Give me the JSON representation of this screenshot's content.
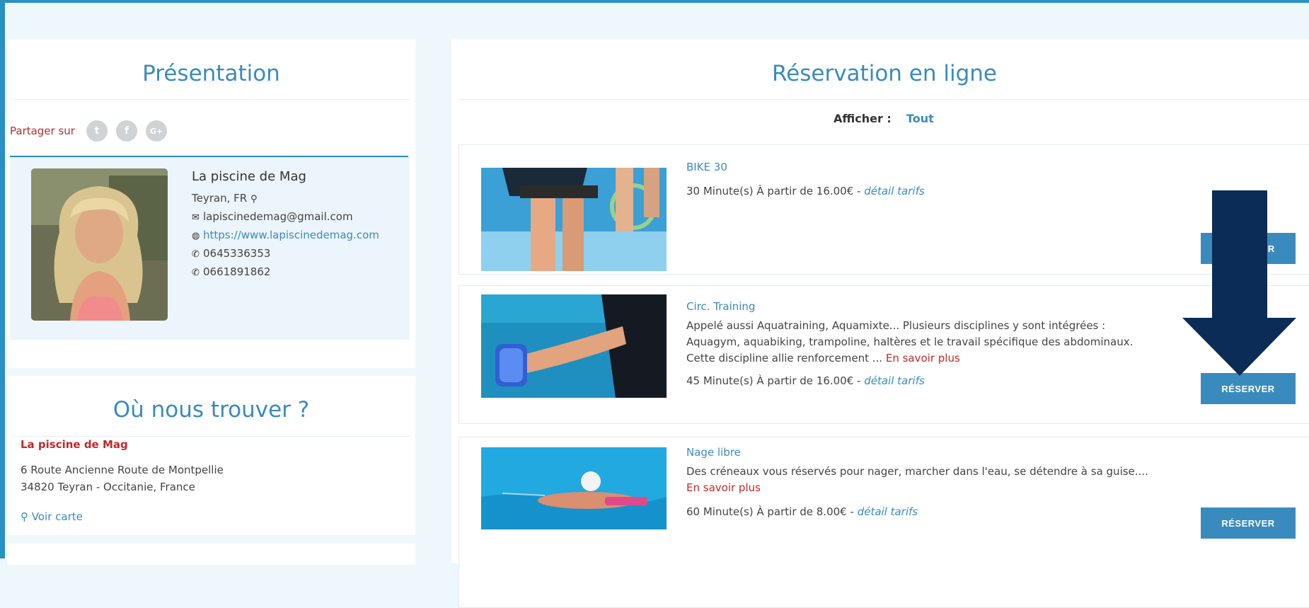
{
  "presentation": {
    "title": "Présentation",
    "share_label": "Partager sur",
    "social": [
      {
        "icon": "twitter-icon",
        "glyph": "t"
      },
      {
        "icon": "facebook-icon",
        "glyph": "f"
      },
      {
        "icon": "google-plus-icon",
        "glyph": "G+"
      }
    ],
    "profile": {
      "name": "La piscine de Mag",
      "location": "Teyran, FR",
      "email": "lapiscinedemag@gmail.com",
      "website": "https://www.lapiscinedemag.com",
      "phone1": "0645336353",
      "phone2": "0661891862"
    }
  },
  "find_us": {
    "title": "Où nous trouver ?",
    "business": "La piscine de Mag",
    "address_line1": "6 Route Ancienne Route de Montpellie",
    "address_line2": "34820 Teyran - Occitanie, France",
    "map_link": "Voir carte"
  },
  "reservation": {
    "title": "Réservation en ligne",
    "filter_label": "Afficher :",
    "filter_value": "Tout",
    "items": [
      {
        "title": "BIKE 30",
        "description": "",
        "more": "",
        "meta": "30 Minute(s) À partir de 16.00€ - ",
        "tariff_link": "détail tarifs",
        "button": "RÉSERVER"
      },
      {
        "title": "Circ. Training",
        "description": "Appelé aussi Aquatraining, Aquamixte... Plusieurs disciplines y sont intégrées : Aquagym, aquabiking, trampoline, haltères et le travail spécifique des abdominaux. Cette discipline allie renforcement ... ",
        "more": "En savoir plus",
        "meta": "45 Minute(s) À partir de 16.00€ - ",
        "tariff_link": "détail tarifs",
        "button": "RÉSERVER"
      },
      {
        "title": "Nage libre",
        "description": "Des créneaux vous réservés pour nager, marcher dans l'eau, se détendre à sa guise.... ",
        "more": "En savoir plus",
        "meta": "60 Minute(s) À partir de 8.00€ - ",
        "tariff_link": "détail tarifs",
        "button": "RÉSERVER"
      }
    ]
  },
  "colors": {
    "accent": "#3a8bbd",
    "link_red": "#c0282a",
    "arrow": "#0b2c57"
  }
}
